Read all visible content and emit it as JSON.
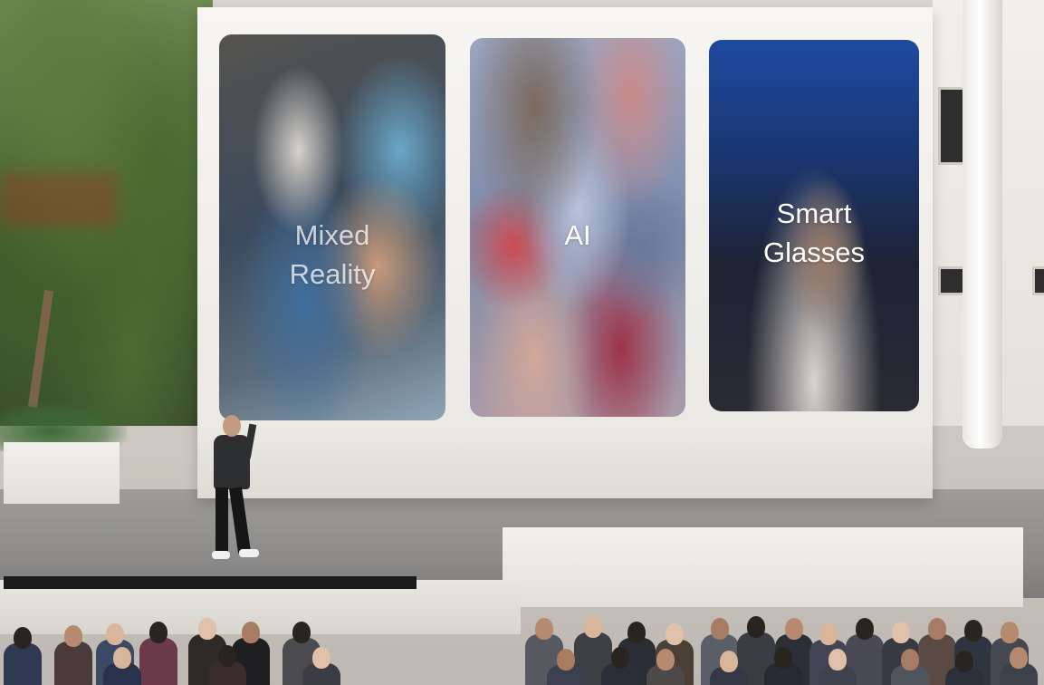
{
  "screens": {
    "left_label": "Mixed Reality",
    "center_label": "AI",
    "right_label": "Smart Glasses"
  }
}
